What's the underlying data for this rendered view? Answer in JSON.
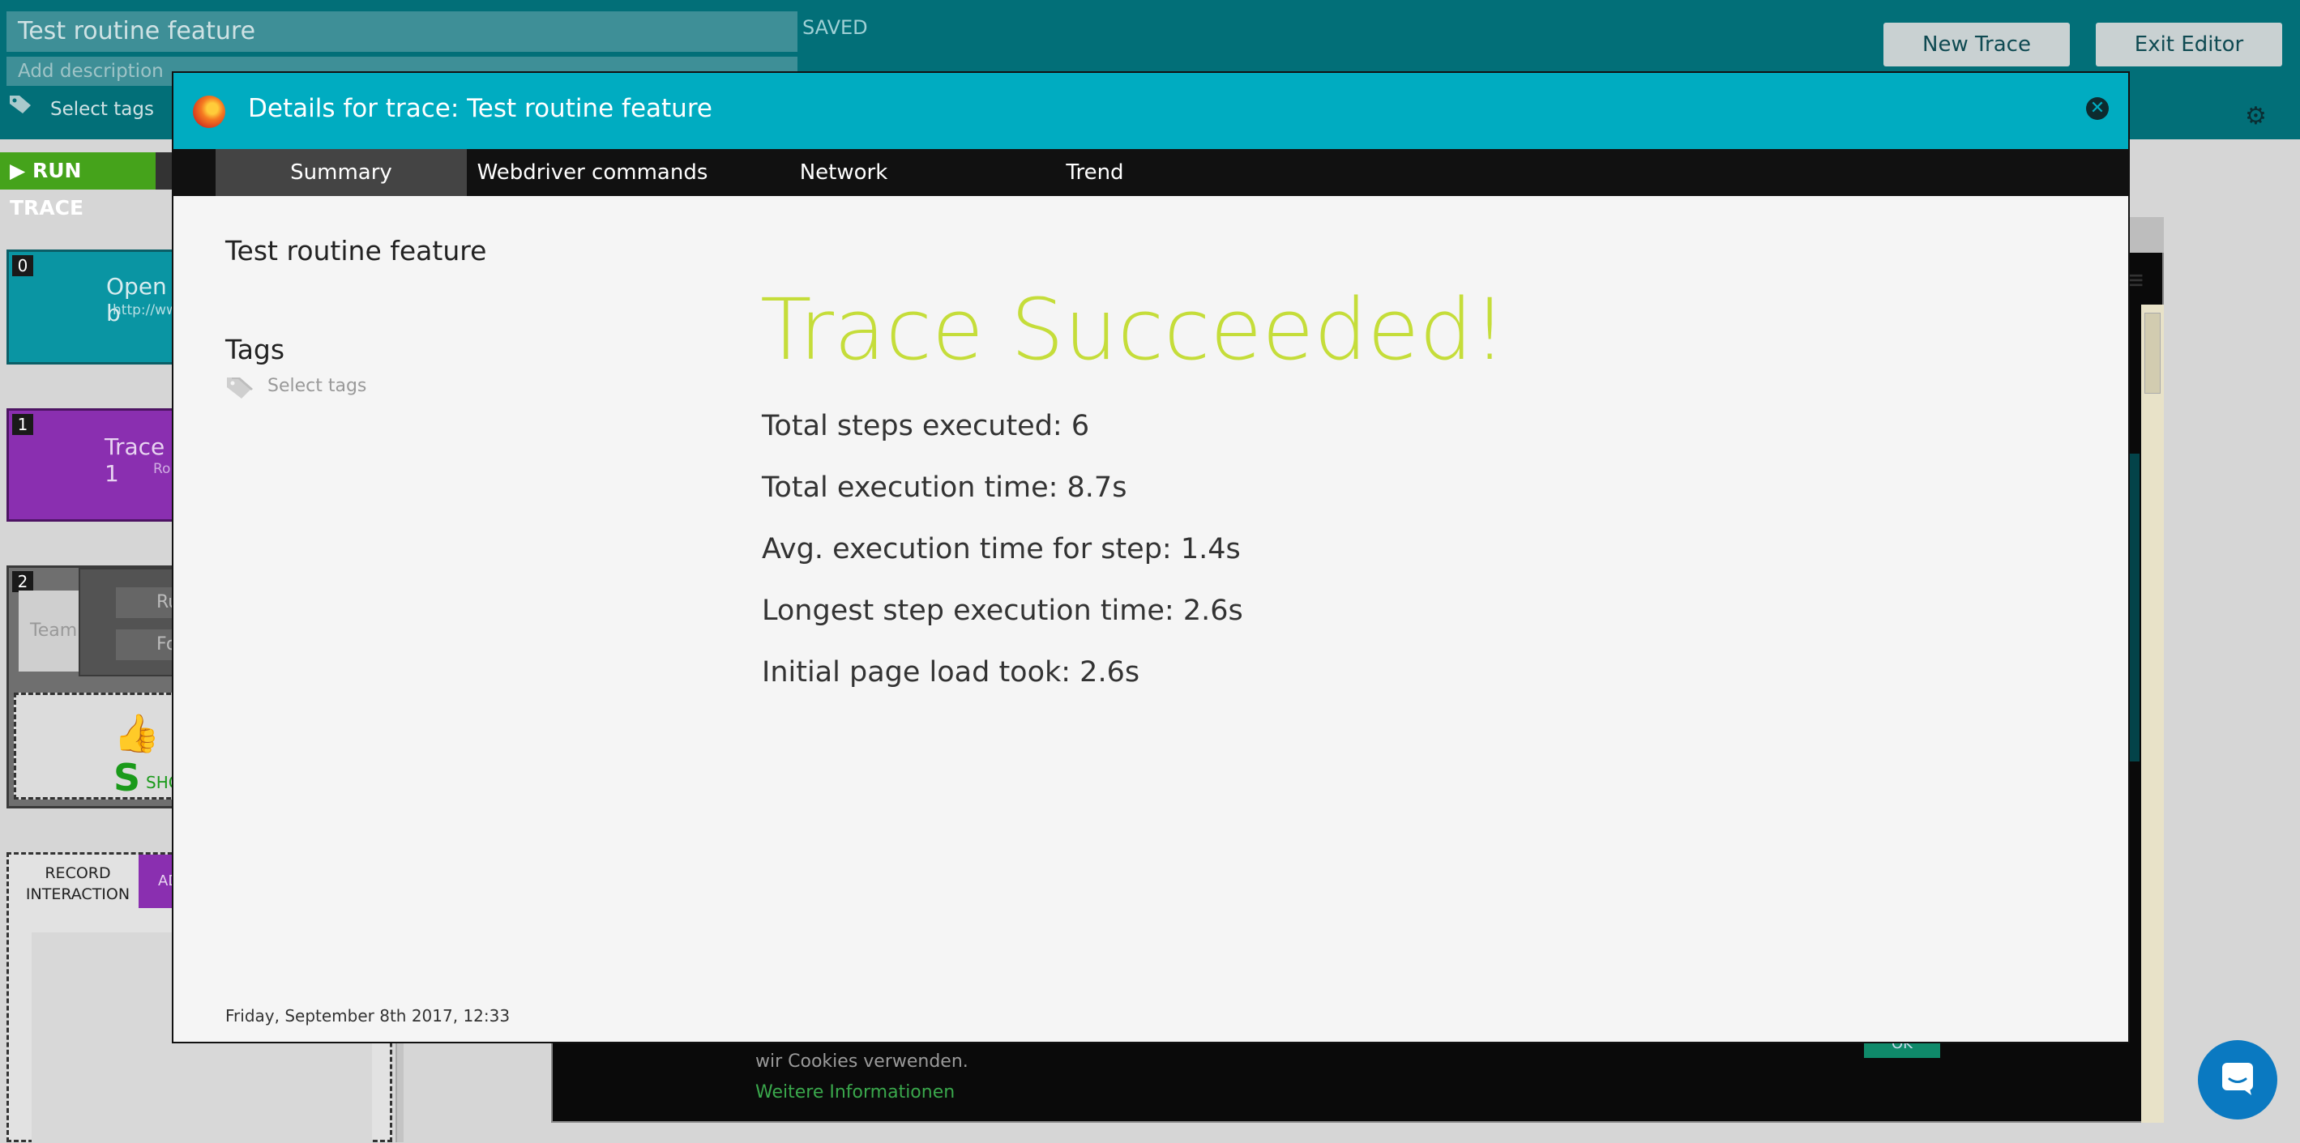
{
  "editor": {
    "title_value": "Test routine feature",
    "description_placeholder": "Add description",
    "saved_label": "SAVED",
    "new_trace_label": "New Trace",
    "exit_editor_label": "Exit Editor",
    "select_tags_label": "Select tags",
    "run_trace_label": "RUN TRACE",
    "record_interaction_label": "RECORD INTERACTION",
    "add_label": "ADI"
  },
  "steps": [
    {
      "number": "0",
      "title": "Open b",
      "subtitle": "http://ww"
    },
    {
      "number": "1",
      "title": "Trace 1",
      "subtitle": "Ro"
    },
    {
      "number": "2",
      "field_text": "Team",
      "btn_1": "Ru",
      "btn_2": "Fo",
      "status": "S",
      "status_label": "SHO"
    }
  ],
  "preview": {
    "cookie_text": "wir Cookies verwenden.",
    "cookie_link": "Weitere Informationen",
    "cookie_ok": "OK"
  },
  "modal": {
    "title": "Details for trace: Test routine feature",
    "tabs": [
      "Summary",
      "Webdriver commands",
      "Network",
      "Trend"
    ],
    "active_tab": "Summary",
    "trace_name": "Test routine feature",
    "tags_heading": "Tags",
    "select_tags": "Select tags",
    "result_heading": "Trace Succeeded!",
    "metrics": [
      "Total steps executed: 6",
      "Total execution time: 8.7s",
      "Avg. execution time for step: 1.4s",
      "Longest step execution time: 2.6s",
      "Initial page load took: 2.6s"
    ],
    "run_date": "Friday, September 8th 2017, 12:33"
  },
  "colors": {
    "header_teal": "#00acc1",
    "topbar_teal": "#026f78",
    "success_green": "#c5dd3a",
    "run_green": "#45a31b",
    "trace_purple": "#8a2fb0",
    "chat_blue": "#0a79c1"
  },
  "icons": {
    "browser": "firefox-icon",
    "close": "close-icon",
    "tag": "tag-icon",
    "settings": "gear-icon",
    "play": "play-icon",
    "chat": "chat-icon",
    "thumb": "thumbs-up-icon",
    "menu": "hamburger-menu-icon"
  }
}
